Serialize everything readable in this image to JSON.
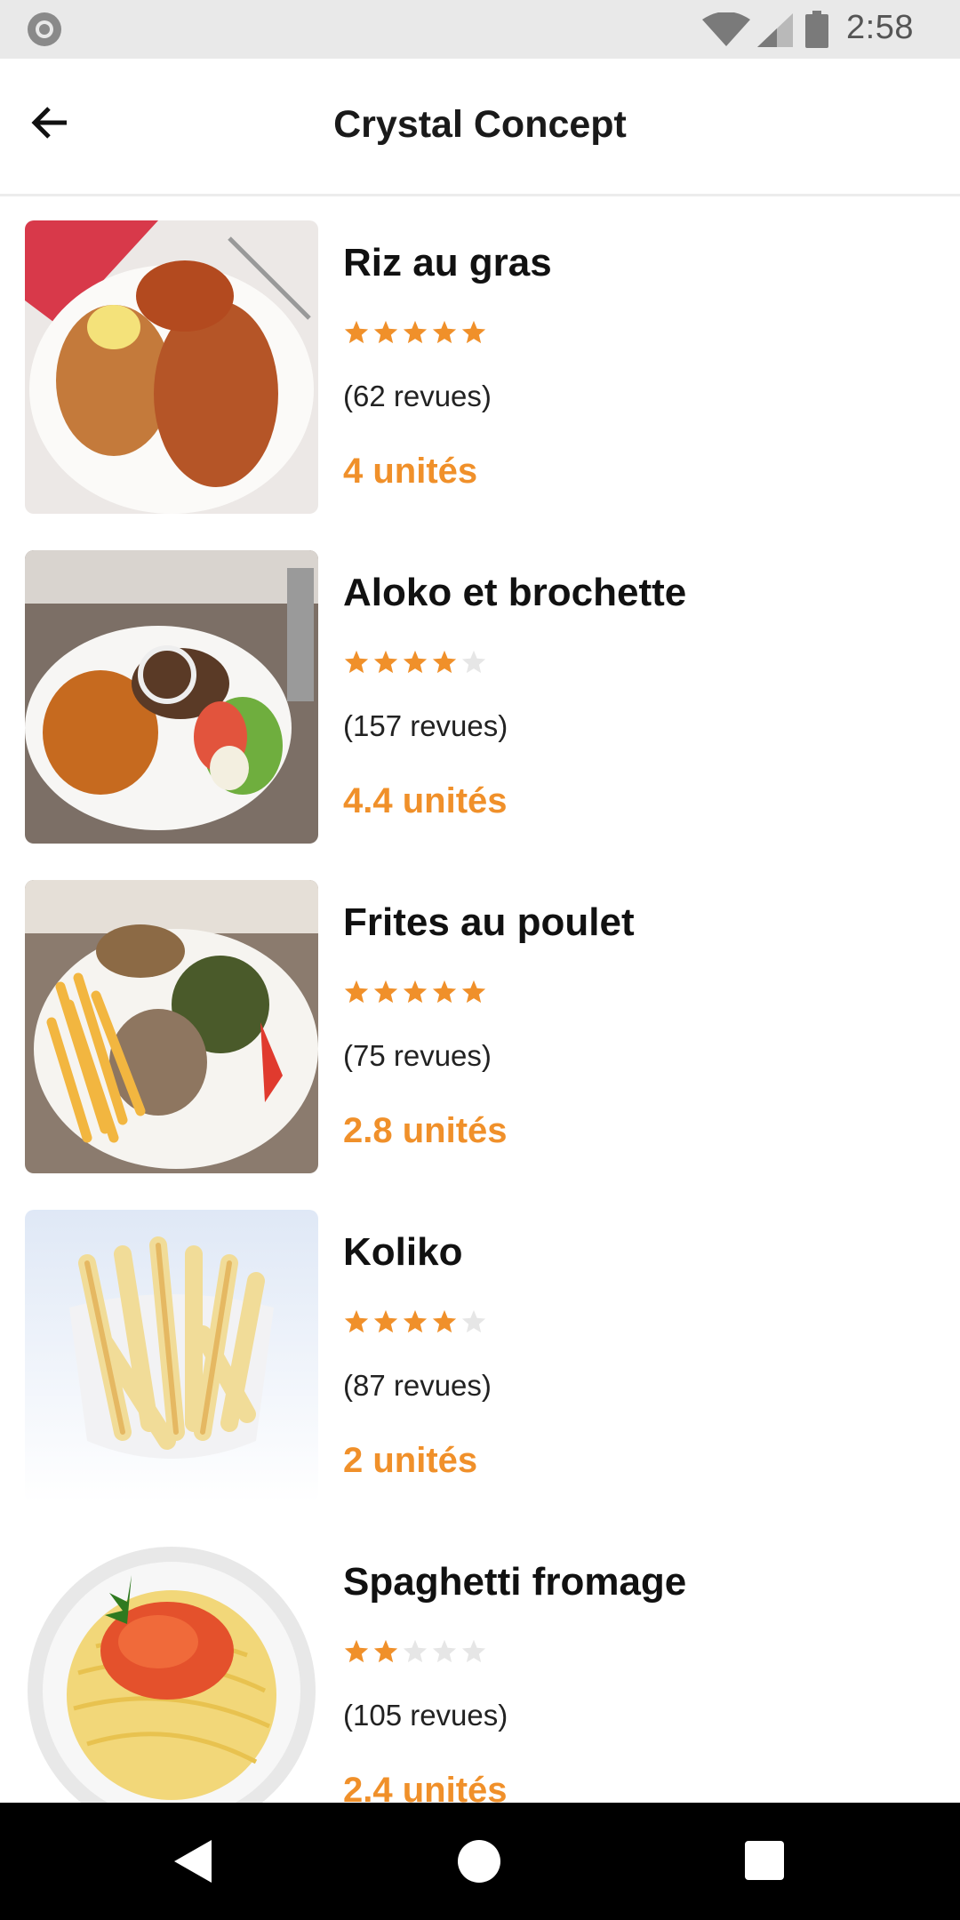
{
  "status_bar": {
    "time": "2:58",
    "icons": [
      "sync-icon",
      "wifi-icon",
      "signal-icon",
      "battery-icon"
    ]
  },
  "app_bar": {
    "title": "Crystal Concept",
    "back_icon": "arrow-left-icon",
    "theme_icon": "moon-icon"
  },
  "colors": {
    "accent": "#f0902a",
    "star_filled": "#f0902a",
    "star_empty": "#e6e6e6"
  },
  "items": [
    {
      "name": "Riz au gras",
      "rating": 5,
      "reviews": "(62 revues)",
      "price": "4 unités",
      "image": "rice-and-fish-plate"
    },
    {
      "name": "Aloko et brochette",
      "rating": 4,
      "reviews": "(157 revues)",
      "price": "4.4 unités",
      "image": "plantain-and-skewers-plate"
    },
    {
      "name": "Frites au poulet",
      "rating": 5,
      "reviews": "(75 revues)",
      "price": "2.8 unités",
      "image": "fries-and-chicken-plate"
    },
    {
      "name": "Koliko",
      "rating": 4,
      "reviews": "(87 revues)",
      "price": "2 unités",
      "image": "fried-yam-bowl"
    },
    {
      "name": "Spaghetti fromage",
      "rating": 2,
      "reviews": "(105 revues)",
      "price": "2.4 unités",
      "image": "spaghetti-plate"
    }
  ],
  "nav_bar": {
    "icons": [
      "nav-back-icon",
      "nav-home-icon",
      "nav-recents-icon"
    ]
  }
}
